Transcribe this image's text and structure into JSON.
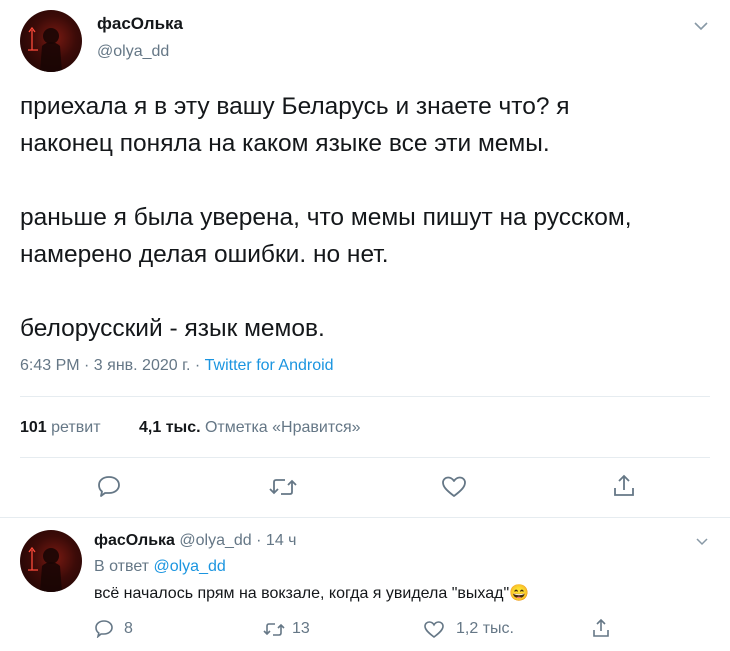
{
  "tweet": {
    "author_name": "фасОлька",
    "author_handle": "@olya_dd",
    "text_lines": [
      "приехала я в эту вашу Беларусь и знаете что? я",
      "наконец поняла на каком языке все эти мемы.",
      "раньше я была уверена, что мемы пишут на русском,",
      "намерено делая ошибки. но нет.",
      "белорусский - язык мемов."
    ],
    "timestamp": "6:43 PM · 3 янв. 2020 г. · ",
    "source": "Twitter for Android",
    "retweets_count": "101",
    "retweets_label": "ретвит",
    "likes_count": "4,1 тыс.",
    "likes_label": "Отметка «Нравится»"
  },
  "actions": {
    "reply_icon": "reply-icon",
    "retweet_icon": "retweet-icon",
    "like_icon": "heart-icon",
    "share_icon": "share-icon"
  },
  "reply": {
    "author_name": "фасОлька",
    "author_handle": "@olya_dd",
    "time": "· 14 ч",
    "reply_to_label": "В ответ",
    "reply_to_handle": "@olya_dd",
    "text": "всё началось прям на вокзале, когда я увидела \"выхад\"",
    "emoji": "😄",
    "replies": "8",
    "retweets": "13",
    "likes": "1,2 тыс."
  },
  "colors": {
    "accent": "#1b95e0",
    "text": "#14171a",
    "muted": "#657786",
    "divider": "#e6ecf0"
  }
}
